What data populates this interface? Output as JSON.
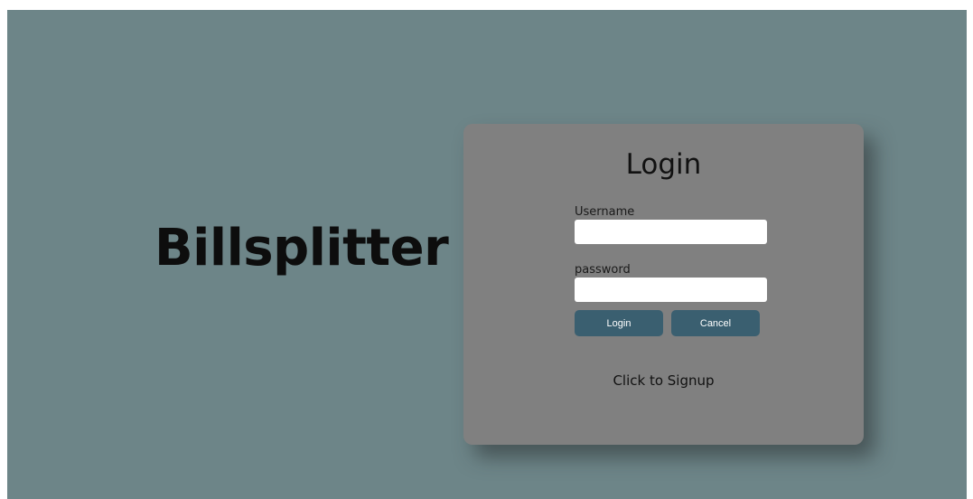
{
  "brand": {
    "name": "Billsplitter"
  },
  "login_form": {
    "title": "Login",
    "username_label": "Username",
    "username_value": "",
    "password_label": "password",
    "password_value": "",
    "login_button": "Login",
    "cancel_button": "Cancel",
    "signup_link": "Click to Signup"
  },
  "colors": {
    "background": "#6d8588",
    "card": "#808080",
    "button": "#3a5f70",
    "button_text": "#ffffff",
    "brand_text": "#0d0d0d"
  }
}
